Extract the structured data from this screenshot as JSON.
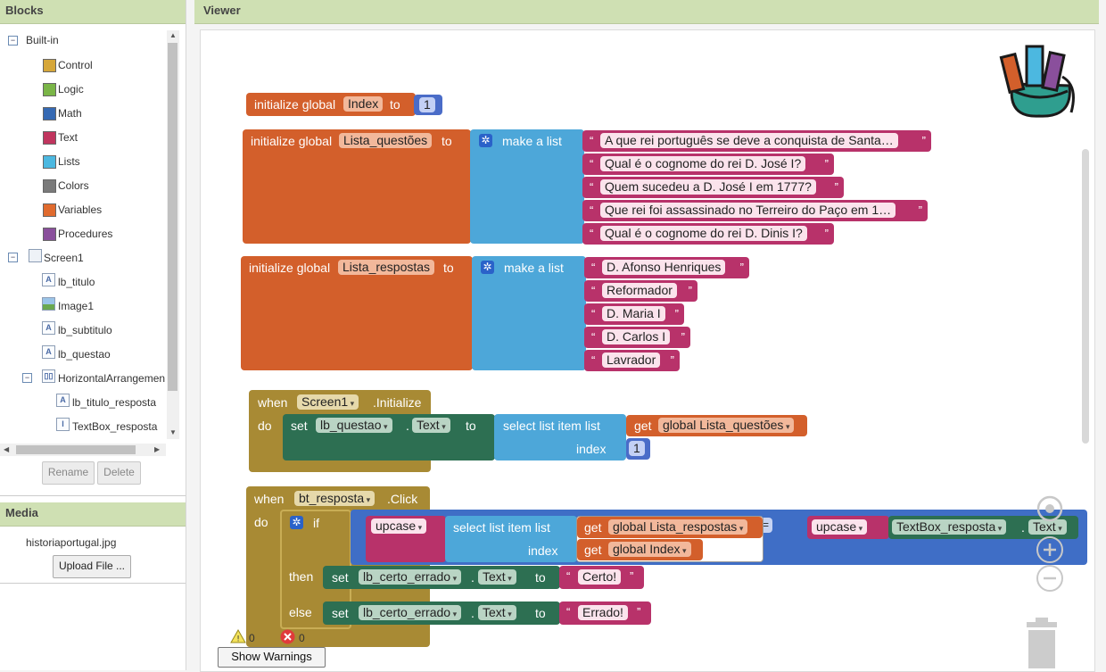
{
  "blocks_panel": {
    "title": "Blocks",
    "builtin": "Built-in",
    "categories": [
      {
        "label": "Control",
        "color": "#d6a73a"
      },
      {
        "label": "Logic",
        "color": "#7ab547"
      },
      {
        "label": "Math",
        "color": "#3569b3"
      },
      {
        "label": "Text",
        "color": "#c0355e"
      },
      {
        "label": "Lists",
        "color": "#4cb8e0"
      },
      {
        "label": "Colors",
        "color": "#7a7a7a"
      },
      {
        "label": "Variables",
        "color": "#e06b2e"
      },
      {
        "label": "Procedures",
        "color": "#8a4f9c"
      }
    ],
    "screen": "Screen1",
    "components": [
      "lb_titulo",
      "Image1",
      "lb_subtitulo",
      "lb_questao"
    ],
    "arrangement": "HorizontalArrangemen",
    "sub_components": [
      "lb_titulo_resposta",
      "TextBox_resposta"
    ],
    "rename_label": "Rename",
    "delete_label": "Delete"
  },
  "media_panel": {
    "title": "Media",
    "file": "historiaportugal.jpg",
    "upload_label": "Upload File ..."
  },
  "viewer": {
    "title": "Viewer",
    "init_index": {
      "kw": "initialize global",
      "name": "Index",
      "to": "to",
      "value": "1"
    },
    "init_questoes": {
      "kw": "initialize global",
      "name": "Lista_questões",
      "to": "to",
      "make": "make a list",
      "items": [
        "A que rei português se deve a conquista de Santa…",
        "Qual é o cognome do rei D. José I?",
        "Quem sucedeu a D. José I em 1777?",
        "Que rei foi assassinado no Terreiro do Paço em 1…",
        "Qual é o cognome do rei D. Dinis I?"
      ]
    },
    "init_respostas": {
      "kw": "initialize global",
      "name": "Lista_respostas",
      "to": "to",
      "make": "make a list",
      "items": [
        "D. Afonso Henriques",
        "Reformador",
        "D. Maria I",
        "D. Carlos I",
        "Lavrador"
      ]
    },
    "screen_init": {
      "when": "when",
      "component": "Screen1",
      "event": ".Initialize",
      "do": "do",
      "set": "set",
      "target": "lb_questao",
      "dot": ".",
      "prop": "Text",
      "to": "to",
      "select": "select list item  list",
      "get": "get",
      "list": "global Lista_questões",
      "index_label": "index",
      "index_value": "1"
    },
    "click_event": {
      "when": "when",
      "component": "bt_resposta",
      "event": ".Click",
      "do": "do",
      "if": "if",
      "upcase": "upcase",
      "select": "select list item  list",
      "get": "get",
      "list": "global Lista_respostas",
      "index_label": "index",
      "index_var": "global Index",
      "op": "=",
      "upcase2": "upcase",
      "textbox": "TextBox_resposta",
      "dot": ".",
      "prop": "Text",
      "then": "then",
      "else": "else",
      "set": "set",
      "label_target": "lb_certo_errado",
      "to": "to",
      "certo": "Certo!",
      "errado": "Errado!"
    },
    "warnings_count": "0",
    "errors_count": "0",
    "show_warnings_label": "Show Warnings"
  }
}
